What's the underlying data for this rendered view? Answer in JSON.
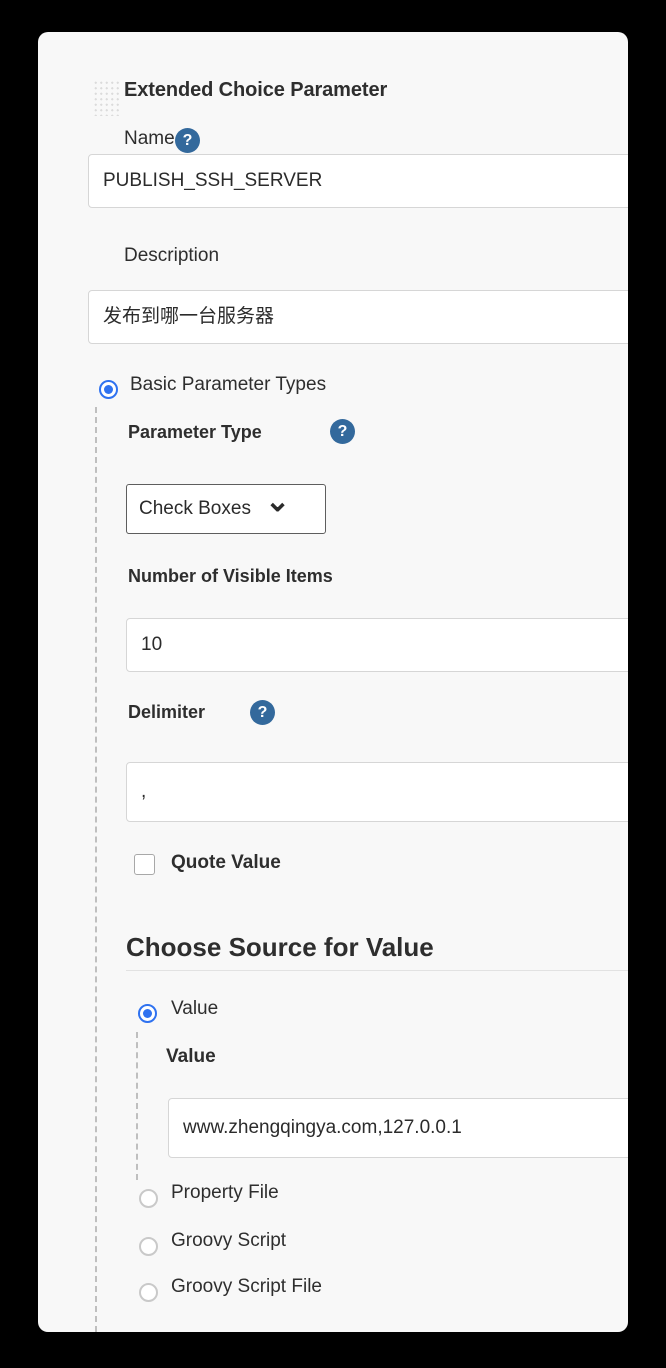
{
  "card": {
    "title": "Extended Choice Parameter",
    "drag_handle_icon": "drag-dots-icon"
  },
  "name_section": {
    "label": "Name",
    "help_icon": "help-circle-icon",
    "value": "PUBLISH_SSH_SERVER",
    "placeholder": ""
  },
  "description_section": {
    "label": "Description",
    "value": "发布到哪一台服务器",
    "placeholder": ""
  },
  "parameter_source": {
    "basic_label": "Basic Parameter Types",
    "basic_selected": true
  },
  "parameter_type": {
    "label": "Parameter Type",
    "help_icon": "help-circle-icon",
    "selected": "Check Boxes",
    "chevron_icon": "chevron-down-icon",
    "options": [
      "Check Boxes"
    ]
  },
  "visible_items": {
    "label": "Number of Visible Items",
    "value": "10",
    "placeholder": ""
  },
  "delimiter": {
    "label": "Delimiter",
    "help_icon": "help-circle-icon",
    "value": ",",
    "placeholder": ""
  },
  "quote_value": {
    "label": "Quote Value",
    "checked": false
  },
  "choose_source": {
    "heading": "Choose Source for Value",
    "options": [
      {
        "label": "Value",
        "selected": true
      },
      {
        "label": "Property File",
        "selected": false
      },
      {
        "label": "Groovy Script",
        "selected": false
      },
      {
        "label": "Groovy Script File",
        "selected": false
      }
    ],
    "value_field": {
      "label": "Value",
      "value": "www.zhengqingya.com,127.0.0.1",
      "placeholder": ""
    }
  },
  "colors": {
    "page_background": "#000000",
    "card_background": "#f8f8f8",
    "field_background": "#ffffff",
    "help_icon_blue": "#33699c",
    "radio_blue": "#2f72f0",
    "text": "#2e2e2e",
    "border": "#d6d6d6"
  }
}
